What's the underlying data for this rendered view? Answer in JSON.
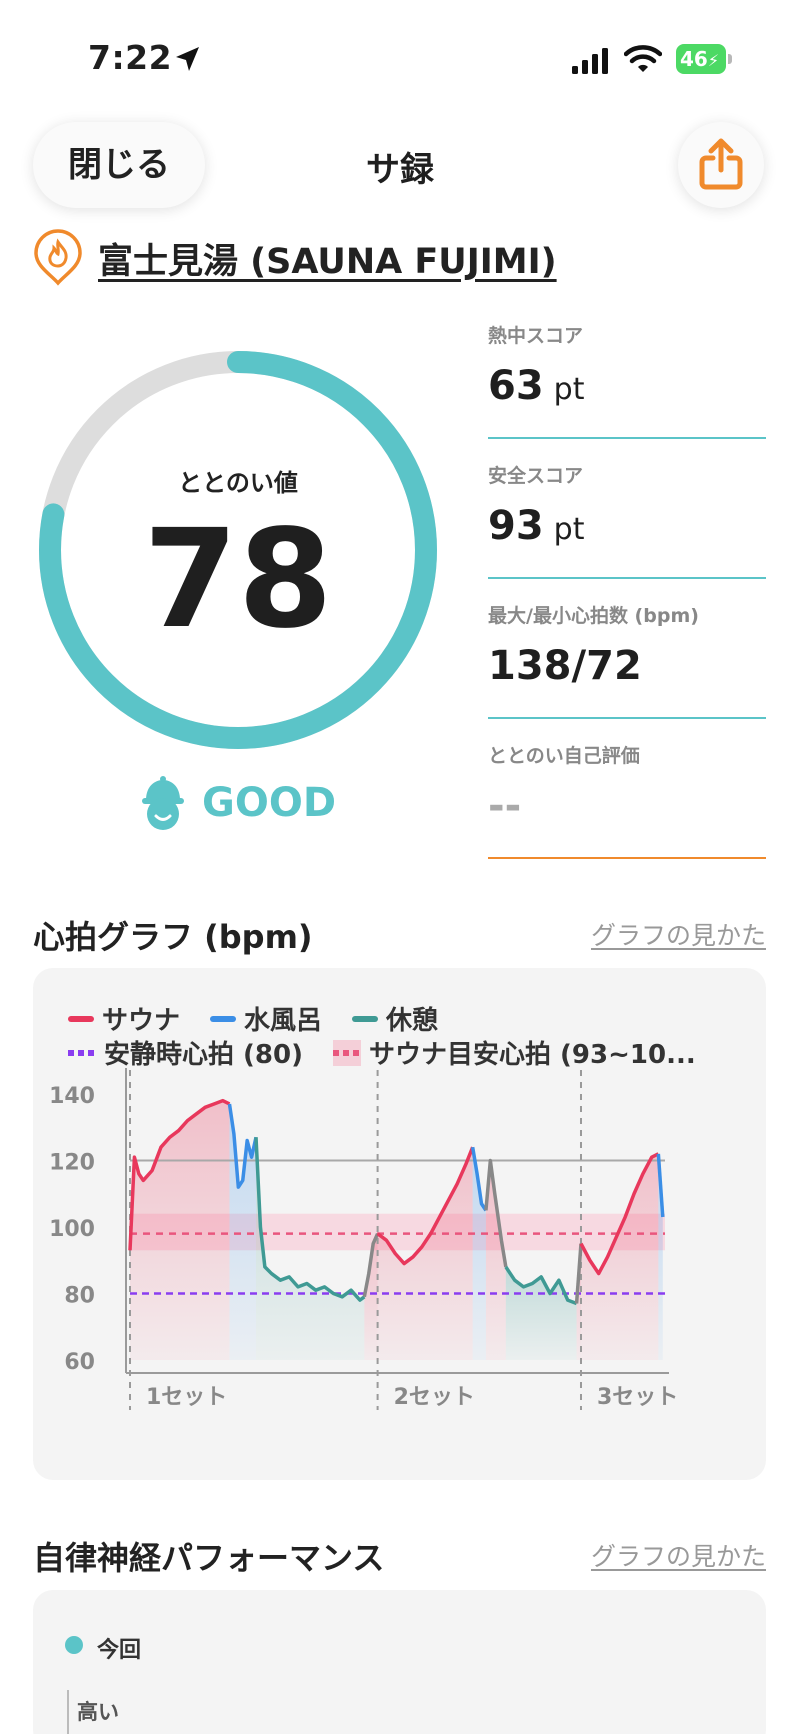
{
  "status_bar": {
    "time": "7:22",
    "battery": "46"
  },
  "nav": {
    "close_label": "閉じる",
    "title": "サ録"
  },
  "facility": {
    "name": "富士見湯 (SAUNA FUJIMI)"
  },
  "score": {
    "label": "ととのい値",
    "value": "78",
    "progress": 0.78,
    "rating": "GOOD"
  },
  "stats": [
    {
      "label": "熱中スコア",
      "value": "63",
      "unit": "pt"
    },
    {
      "label": "安全スコア",
      "value": "93",
      "unit": "pt"
    },
    {
      "label": "最大/最小心拍数 (bpm)",
      "value": "138/72",
      "unit": ""
    },
    {
      "label": "ととのい自己評価",
      "value": "--",
      "unit": ""
    }
  ],
  "heart_section": {
    "title": "心拍グラフ (bpm)",
    "help_link": "グラフの見かた"
  },
  "legend": {
    "sauna": "サウナ",
    "cold_bath": "水風呂",
    "rest": "休憩",
    "resting_hr": "安静時心拍 (80)",
    "sauna_target": "サウナ目安心拍 (93~10..."
  },
  "colors": {
    "accent": "#5bc4c8",
    "orange": "#f08a2c",
    "sauna": "#e8385c",
    "cold_bath": "#3b8ee6",
    "rest": "#3f9a94",
    "resting_hr": "#8a3df0",
    "target": "#e9567d"
  },
  "chart_data": {
    "type": "line",
    "title": "心拍グラフ (bpm)",
    "xlabel": "",
    "ylabel": "",
    "ylim": [
      60,
      140
    ],
    "y_ticks": [
      140,
      120,
      100,
      80,
      60
    ],
    "x_ticks": [
      "1セット",
      "2セット",
      "3セット"
    ],
    "resting_hr": 80,
    "target_band": [
      93,
      104
    ],
    "target_line": 98,
    "reference_line": 120,
    "grid": false,
    "legend_position": "top-left",
    "series": [
      {
        "name": "サウナ",
        "phase": "sauna",
        "x": [
          0,
          1,
          2,
          3,
          5,
          7,
          9,
          11,
          13,
          15,
          17,
          19,
          21,
          22.5
        ],
        "y": [
          93,
          121,
          116,
          114,
          117,
          124,
          127,
          129,
          132,
          134,
          136,
          137,
          138,
          137
        ]
      },
      {
        "name": "水風呂",
        "phase": "cold",
        "x": [
          22.5,
          23.5,
          24.5,
          25.5,
          26.5,
          27.5,
          28.5
        ],
        "y": [
          137,
          128,
          112,
          114,
          126,
          121,
          127
        ]
      },
      {
        "name": "休憩",
        "phase": "rest",
        "x": [
          28.5,
          29.5,
          30.5,
          32,
          34,
          36,
          38,
          40,
          42,
          44,
          46,
          48,
          50,
          52,
          53
        ],
        "y": [
          127,
          100,
          88,
          86,
          84,
          85,
          82,
          83,
          81,
          82,
          80,
          79,
          81,
          78,
          79
        ]
      },
      {
        "name": "休憩",
        "phase": "transition",
        "x": [
          53,
          54,
          55,
          56
        ],
        "y": [
          79,
          86,
          95,
          98
        ]
      },
      {
        "name": "サウナ",
        "phase": "sauna",
        "x": [
          56,
          58,
          60,
          62,
          64,
          66,
          68,
          70,
          72,
          74,
          76,
          77.5
        ],
        "y": [
          98,
          96,
          92,
          89,
          91,
          94,
          98,
          103,
          108,
          113,
          119,
          124
        ]
      },
      {
        "name": "水風呂",
        "phase": "cold",
        "x": [
          77.5,
          78.5,
          79.5,
          80.5
        ],
        "y": [
          124,
          116,
          107,
          105
        ]
      },
      {
        "name": "休憩",
        "phase": "transition",
        "x": [
          80.5,
          81.5,
          82.5,
          84,
          85
        ],
        "y": [
          105,
          120,
          110,
          96,
          88
        ]
      },
      {
        "name": "休憩",
        "phase": "rest",
        "x": [
          85,
          87,
          89,
          91,
          93,
          95,
          97,
          99,
          101
        ],
        "y": [
          88,
          84,
          82,
          83,
          85,
          80,
          84,
          78,
          77
        ]
      },
      {
        "name": "休憩",
        "phase": "transition",
        "x": [
          101,
          102
        ],
        "y": [
          77,
          95
        ]
      },
      {
        "name": "サウナ",
        "phase": "sauna",
        "x": [
          102,
          104,
          106,
          108,
          110,
          112,
          114,
          116,
          118,
          119.5
        ],
        "y": [
          95,
          90,
          86,
          91,
          97,
          103,
          110,
          116,
          121,
          122
        ]
      },
      {
        "name": "水風呂",
        "phase": "cold",
        "x": [
          119.5,
          120.5
        ],
        "y": [
          122,
          103
        ]
      }
    ]
  },
  "autonomic_section": {
    "title": "自律神経パフォーマンス",
    "help_link": "グラフの見かた",
    "legend_current": "今回",
    "axis_high": "高い"
  }
}
